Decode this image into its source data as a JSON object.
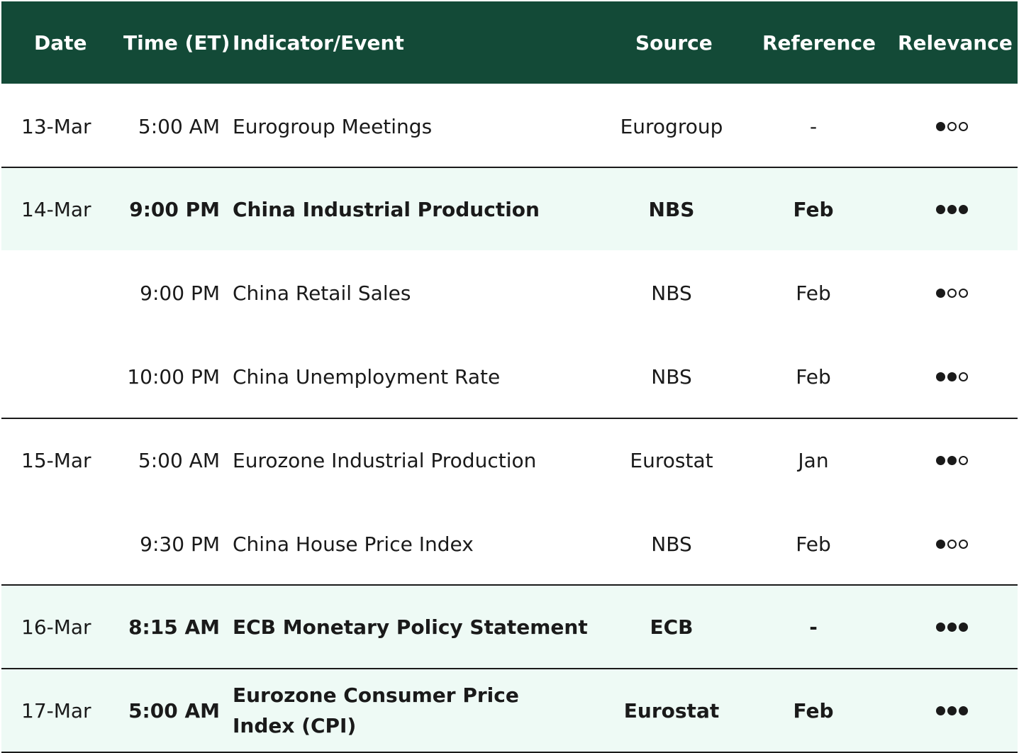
{
  "table": {
    "headers": {
      "date": "Date",
      "time": "Time (ET)",
      "event": "Indicator/Event",
      "source": "Source",
      "reference": "Reference",
      "relevance": "Relevance"
    },
    "rows": [
      {
        "date": "13-Mar",
        "time": "5:00 AM",
        "event": "Eurogroup Meetings",
        "source": "Eurogroup",
        "reference": "-",
        "relevance": 1,
        "highlighted": false
      },
      {
        "date": "14-Mar",
        "time": "9:00 PM",
        "event": "China Industrial Production",
        "source": "NBS",
        "reference": "Feb",
        "relevance": 3,
        "highlighted": true
      },
      {
        "date": "",
        "time": "9:00 PM",
        "event": "China Retail Sales",
        "source": "NBS",
        "reference": "Feb",
        "relevance": 1,
        "highlighted": false
      },
      {
        "date": "",
        "time": "10:00 PM",
        "event": "China Unemployment Rate",
        "source": "NBS",
        "reference": "Feb",
        "relevance": 2,
        "highlighted": false
      },
      {
        "date": "15-Mar",
        "time": "5:00 AM",
        "event": "Eurozone Industrial Production",
        "source": "Eurostat",
        "reference": "Jan",
        "relevance": 2,
        "highlighted": false
      },
      {
        "date": "",
        "time": "9:30 PM",
        "event": "China House Price Index",
        "source": "NBS",
        "reference": "Feb",
        "relevance": 1,
        "highlighted": false
      },
      {
        "date": "16-Mar",
        "time": "8:15 AM",
        "event": "ECB Monetary Policy Statement",
        "source": "ECB",
        "reference": "-",
        "relevance": 3,
        "highlighted": true
      },
      {
        "date": "17-Mar",
        "time": "5:00 AM",
        "event": "Eurozone Consumer Price Index (CPI)",
        "source": "Eurostat",
        "reference": "Feb",
        "relevance": 3,
        "highlighted": true
      }
    ]
  },
  "colors": {
    "header_bg": "#134a37",
    "header_text": "#ffffff",
    "highlight_bg": "#eefaf5",
    "text": "#1a1a1a"
  },
  "relevance_max": 3
}
